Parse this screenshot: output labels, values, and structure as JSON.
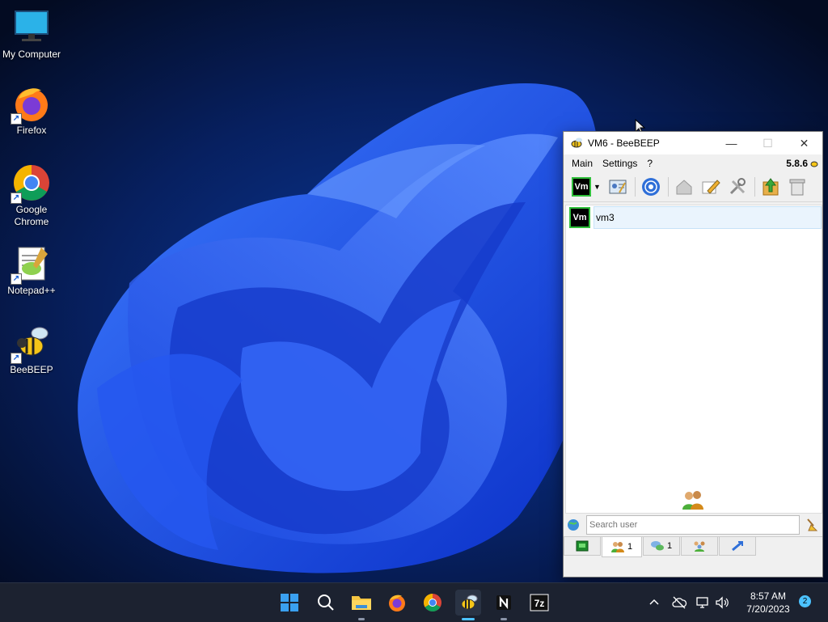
{
  "desktop": {
    "icons": [
      {
        "label": "My Computer"
      },
      {
        "label": "Firefox"
      },
      {
        "label": "Google Chrome"
      },
      {
        "label": "Notepad++"
      },
      {
        "label": "BeeBEEP"
      }
    ]
  },
  "window": {
    "title": "VM6 - BeeBEEP",
    "menu": [
      "Main",
      "Settings",
      "?"
    ],
    "version": "5.8.6",
    "users": [
      {
        "badge": "Vm",
        "name": "vm3"
      }
    ],
    "search_placeholder": "Search user",
    "tabs": [
      {
        "icon": "status-icon",
        "count": ""
      },
      {
        "icon": "users-icon",
        "count": "1"
      },
      {
        "icon": "chat-icon",
        "count": "1"
      },
      {
        "icon": "groups-icon",
        "count": ""
      },
      {
        "icon": "share-icon",
        "count": ""
      }
    ]
  },
  "taskbar": {
    "apps": [
      "start-icon",
      "search-icon",
      "file-explorer-icon",
      "firefox-icon",
      "chrome-icon",
      "beebeep-icon",
      "notion-icon",
      "7zip-icon"
    ],
    "clock_time": "8:57 AM",
    "clock_date": "7/20/2023",
    "notification_count": "2"
  },
  "colors": {
    "accent": "#4cc2ff",
    "online": "#2fbf3a",
    "selection": "#eaf4fd"
  }
}
